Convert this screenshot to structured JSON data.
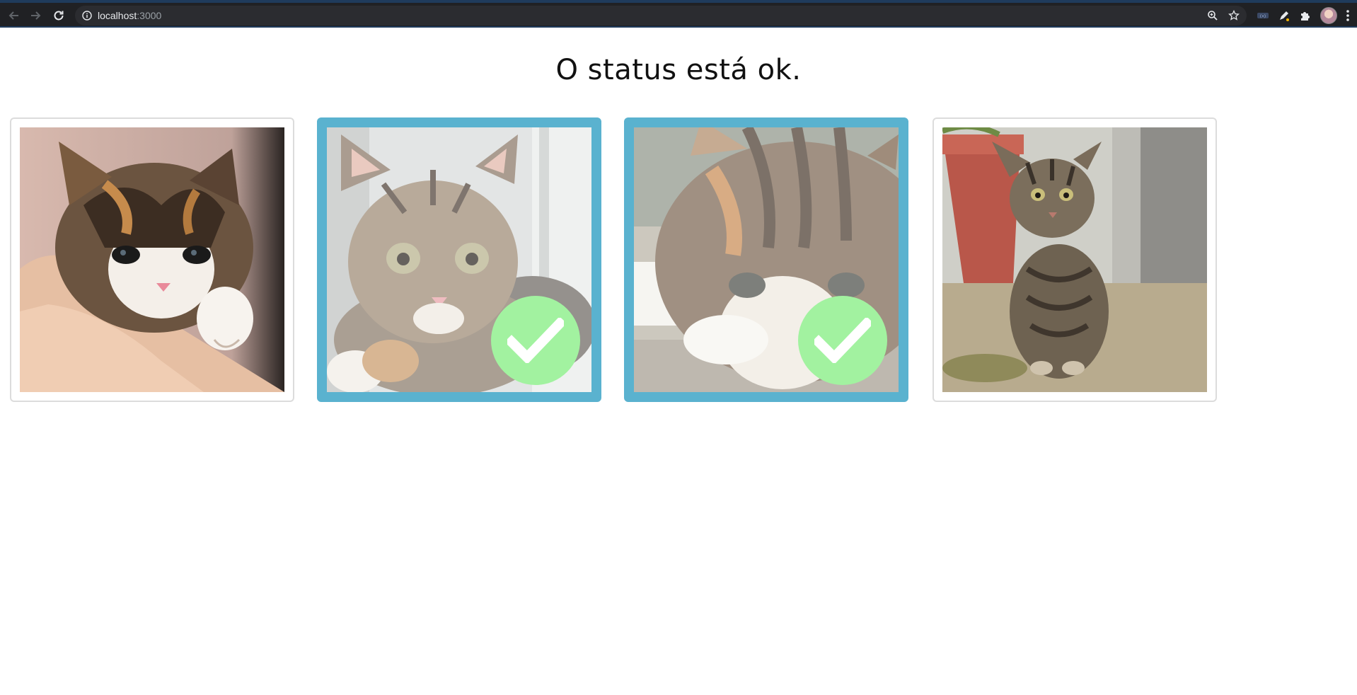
{
  "browser": {
    "url_host": "localhost",
    "url_port": ":3000",
    "icons": [
      "back-arrow-icon",
      "forward-arrow-icon",
      "reload-icon",
      "info-icon",
      "zoom-icon",
      "star-icon",
      "extension-icon",
      "pen-icon",
      "puzzle-icon",
      "avatar",
      "kebab-menu-icon"
    ],
    "chrome_color": "#202124",
    "accent_color": "#1f3b5c"
  },
  "page": {
    "title": "O status está ok."
  },
  "cards": [
    {
      "subject": "kitten held in hand",
      "selected": false
    },
    {
      "subject": "tabby kitten lying by window",
      "selected": true
    },
    {
      "subject": "close-up kitten face",
      "selected": true
    },
    {
      "subject": "tabby kitten sitting by flower pot",
      "selected": false
    }
  ],
  "colors": {
    "selected_border": "#5ab2cf",
    "check_badge": "#a2f2a0",
    "card_border": "#dcdcdc"
  }
}
